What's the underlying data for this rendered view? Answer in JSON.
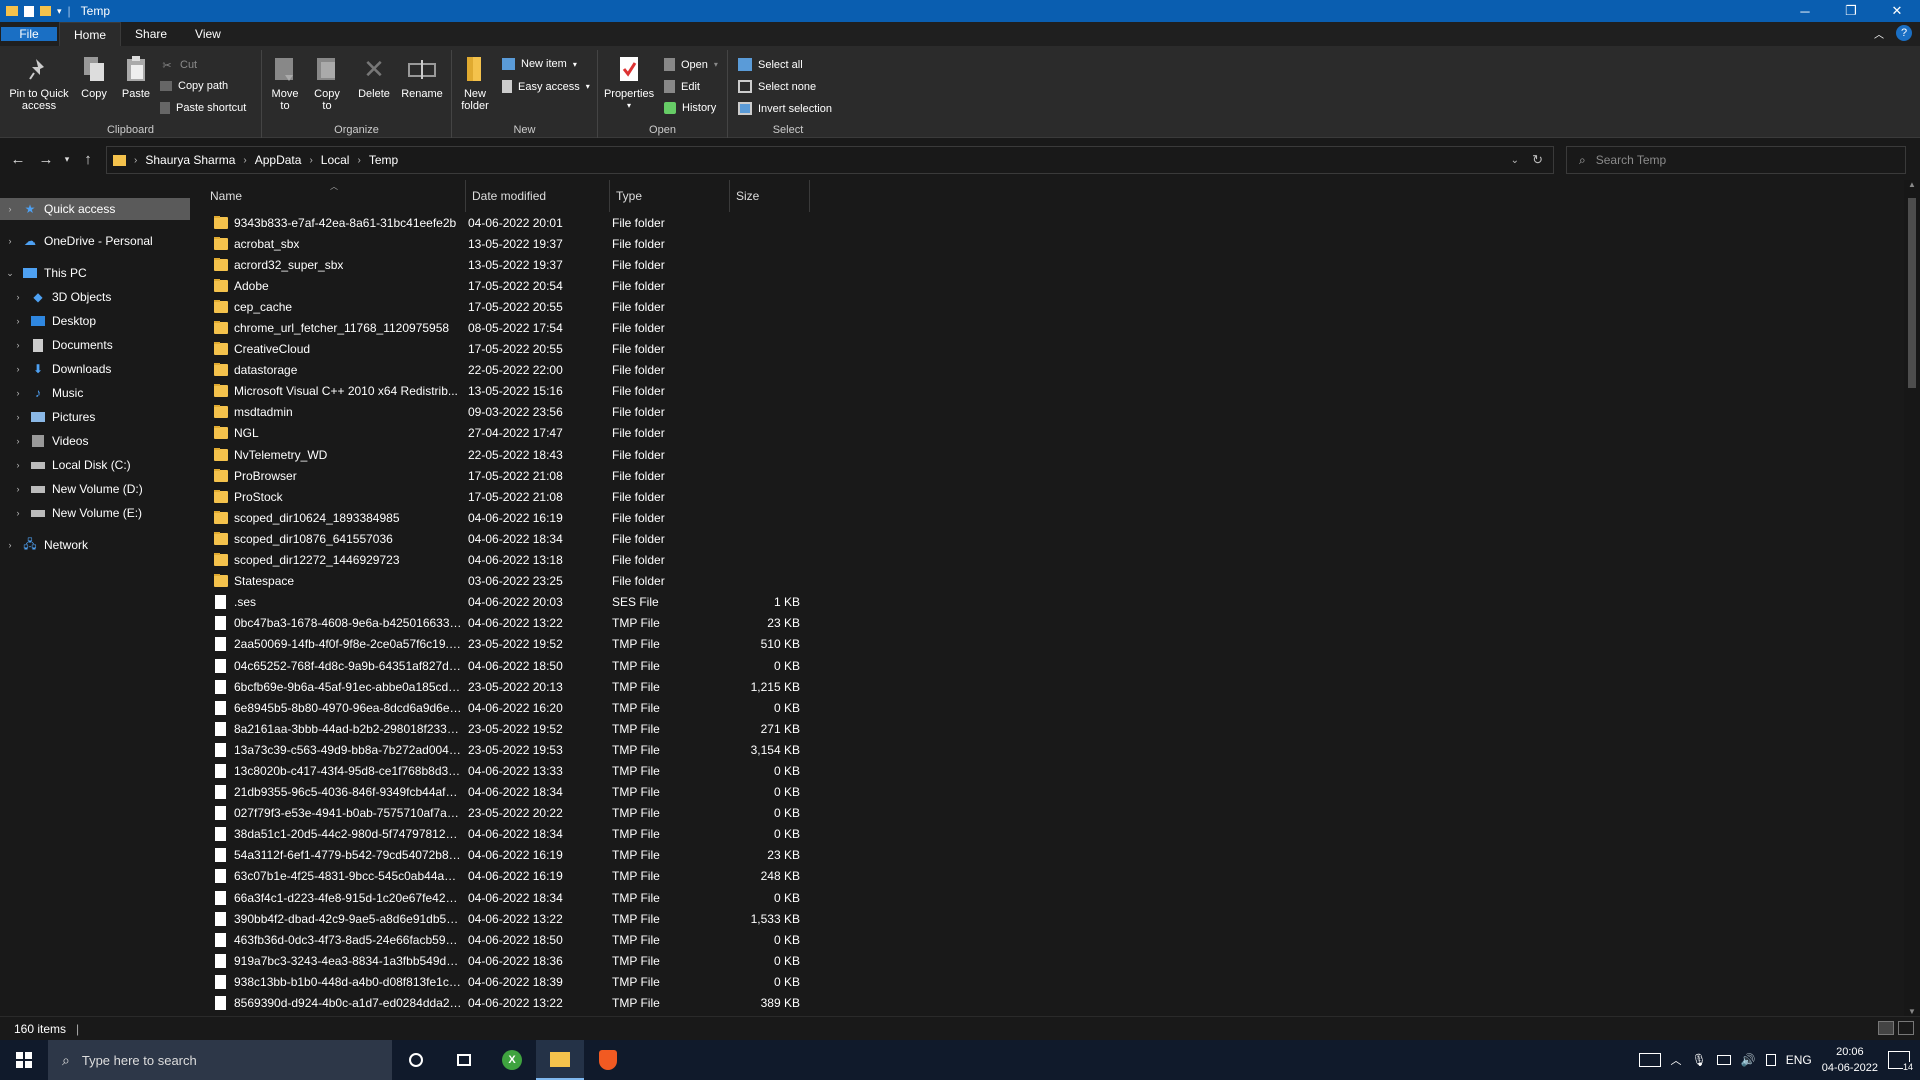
{
  "window": {
    "title": "Temp",
    "controls": {
      "minimize": "─",
      "restore": "❐",
      "close": "✕"
    }
  },
  "ribbon_tabs": [
    "File",
    "Home",
    "Share",
    "View"
  ],
  "ribbon": {
    "clipboard": {
      "label": "Clipboard",
      "pin": "Pin to Quick access",
      "copy": "Copy",
      "paste": "Paste",
      "cut": "Cut",
      "copy_path": "Copy path",
      "paste_shortcut": "Paste shortcut"
    },
    "organize": {
      "label": "Organize",
      "move_to": "Move to",
      "copy_to": "Copy to",
      "delete": "Delete",
      "rename": "Rename"
    },
    "new": {
      "label": "New",
      "new_folder": "New folder",
      "new_item": "New item",
      "easy_access": "Easy access"
    },
    "open": {
      "label": "Open",
      "properties": "Properties",
      "open": "Open",
      "edit": "Edit",
      "history": "History"
    },
    "select": {
      "label": "Select",
      "select_all": "Select all",
      "select_none": "Select none",
      "invert": "Invert selection"
    }
  },
  "breadcrumb": [
    "Shaurya Sharma",
    "AppData",
    "Local",
    "Temp"
  ],
  "search": {
    "placeholder": "Search Temp"
  },
  "nav": {
    "quick_access": "Quick access",
    "onedrive": "OneDrive - Personal",
    "this_pc": "This PC",
    "objects3d": "3D Objects",
    "desktop": "Desktop",
    "documents": "Documents",
    "downloads": "Downloads",
    "music": "Music",
    "pictures": "Pictures",
    "videos": "Videos",
    "local_c": "Local Disk (C:)",
    "vol_d": "New Volume (D:)",
    "vol_e": "New Volume (E:)",
    "network": "Network"
  },
  "columns": {
    "name": "Name",
    "date": "Date modified",
    "type": "Type",
    "size": "Size"
  },
  "files": [
    {
      "name": "9343b833-e7af-42ea-8a61-31bc41eefe2b",
      "date": "04-06-2022 20:01",
      "type": "File folder",
      "size": "",
      "kind": "folder"
    },
    {
      "name": "acrobat_sbx",
      "date": "13-05-2022 19:37",
      "type": "File folder",
      "size": "",
      "kind": "folder"
    },
    {
      "name": "acrord32_super_sbx",
      "date": "13-05-2022 19:37",
      "type": "File folder",
      "size": "",
      "kind": "folder"
    },
    {
      "name": "Adobe",
      "date": "17-05-2022 20:54",
      "type": "File folder",
      "size": "",
      "kind": "folder"
    },
    {
      "name": "cep_cache",
      "date": "17-05-2022 20:55",
      "type": "File folder",
      "size": "",
      "kind": "folder"
    },
    {
      "name": "chrome_url_fetcher_11768_1120975958",
      "date": "08-05-2022 17:54",
      "type": "File folder",
      "size": "",
      "kind": "folder"
    },
    {
      "name": "CreativeCloud",
      "date": "17-05-2022 20:55",
      "type": "File folder",
      "size": "",
      "kind": "folder"
    },
    {
      "name": "datastorage",
      "date": "22-05-2022 22:00",
      "type": "File folder",
      "size": "",
      "kind": "folder"
    },
    {
      "name": "Microsoft Visual C++ 2010  x64 Redistrib...",
      "date": "13-05-2022 15:16",
      "type": "File folder",
      "size": "",
      "kind": "folder"
    },
    {
      "name": "msdtadmin",
      "date": "09-03-2022 23:56",
      "type": "File folder",
      "size": "",
      "kind": "folder"
    },
    {
      "name": "NGL",
      "date": "27-04-2022 17:47",
      "type": "File folder",
      "size": "",
      "kind": "folder"
    },
    {
      "name": "NvTelemetry_WD",
      "date": "22-05-2022 18:43",
      "type": "File folder",
      "size": "",
      "kind": "folder"
    },
    {
      "name": "ProBrowser",
      "date": "17-05-2022 21:08",
      "type": "File folder",
      "size": "",
      "kind": "folder"
    },
    {
      "name": "ProStock",
      "date": "17-05-2022 21:08",
      "type": "File folder",
      "size": "",
      "kind": "folder"
    },
    {
      "name": "scoped_dir10624_1893384985",
      "date": "04-06-2022 16:19",
      "type": "File folder",
      "size": "",
      "kind": "folder"
    },
    {
      "name": "scoped_dir10876_641557036",
      "date": "04-06-2022 18:34",
      "type": "File folder",
      "size": "",
      "kind": "folder"
    },
    {
      "name": "scoped_dir12272_1446929723",
      "date": "04-06-2022 13:18",
      "type": "File folder",
      "size": "",
      "kind": "folder"
    },
    {
      "name": "Statespace",
      "date": "03-06-2022 23:25",
      "type": "File folder",
      "size": "",
      "kind": "folder"
    },
    {
      "name": ".ses",
      "date": "04-06-2022 20:03",
      "type": "SES File",
      "size": "1 KB",
      "kind": "file"
    },
    {
      "name": "0bc47ba3-1678-4608-9e6a-b42501663338...",
      "date": "04-06-2022 13:22",
      "type": "TMP File",
      "size": "23 KB",
      "kind": "file"
    },
    {
      "name": "2aa50069-14fb-4f0f-9f8e-2ce0a57f6c19.t...",
      "date": "23-05-2022 19:52",
      "type": "TMP File",
      "size": "510 KB",
      "kind": "file"
    },
    {
      "name": "04c65252-768f-4d8c-9a9b-64351af827da...",
      "date": "04-06-2022 18:50",
      "type": "TMP File",
      "size": "0 KB",
      "kind": "file"
    },
    {
      "name": "6bcfb69e-9b6a-45af-91ec-abbe0a185cd6...",
      "date": "23-05-2022 20:13",
      "type": "TMP File",
      "size": "1,215 KB",
      "kind": "file"
    },
    {
      "name": "6e8945b5-8b80-4970-96ea-8dcd6a9d6e5f...",
      "date": "04-06-2022 16:20",
      "type": "TMP File",
      "size": "0 KB",
      "kind": "file"
    },
    {
      "name": "8a2161aa-3bbb-44ad-b2b2-298018f23323...",
      "date": "23-05-2022 19:52",
      "type": "TMP File",
      "size": "271 KB",
      "kind": "file"
    },
    {
      "name": "13a73c39-c563-49d9-bb8a-7b272ad00445...",
      "date": "23-05-2022 19:53",
      "type": "TMP File",
      "size": "3,154 KB",
      "kind": "file"
    },
    {
      "name": "13c8020b-c417-43f4-95d8-ce1f768b8d33...",
      "date": "04-06-2022 13:33",
      "type": "TMP File",
      "size": "0 KB",
      "kind": "file"
    },
    {
      "name": "21db9355-96c5-4036-846f-9349fcb44af6.t...",
      "date": "04-06-2022 18:34",
      "type": "TMP File",
      "size": "0 KB",
      "kind": "file"
    },
    {
      "name": "027f79f3-e53e-4941-b0ab-7575710af7a1.t...",
      "date": "23-05-2022 20:22",
      "type": "TMP File",
      "size": "0 KB",
      "kind": "file"
    },
    {
      "name": "38da51c1-20d5-44c2-980d-5f74797812e0...",
      "date": "04-06-2022 18:34",
      "type": "TMP File",
      "size": "0 KB",
      "kind": "file"
    },
    {
      "name": "54a3112f-6ef1-4779-b542-79cd54072b8f.t...",
      "date": "04-06-2022 16:19",
      "type": "TMP File",
      "size": "23 KB",
      "kind": "file"
    },
    {
      "name": "63c07b1e-4f25-4831-9bcc-545c0ab44a10...",
      "date": "04-06-2022 16:19",
      "type": "TMP File",
      "size": "248 KB",
      "kind": "file"
    },
    {
      "name": "66a3f4c1-d223-4fe8-915d-1c20e67fe422.t...",
      "date": "04-06-2022 18:34",
      "type": "TMP File",
      "size": "0 KB",
      "kind": "file"
    },
    {
      "name": "390bb4f2-dbad-42c9-9ae5-a8d6e91db58...",
      "date": "04-06-2022 13:22",
      "type": "TMP File",
      "size": "1,533 KB",
      "kind": "file"
    },
    {
      "name": "463fb36d-0dc3-4f73-8ad5-24e66facb59c....",
      "date": "04-06-2022 18:50",
      "type": "TMP File",
      "size": "0 KB",
      "kind": "file"
    },
    {
      "name": "919a7bc3-3243-4ea3-8834-1a3fbb549d0f....",
      "date": "04-06-2022 18:36",
      "type": "TMP File",
      "size": "0 KB",
      "kind": "file"
    },
    {
      "name": "938c13bb-b1b0-448d-a4b0-d08f813fe1cd...",
      "date": "04-06-2022 18:39",
      "type": "TMP File",
      "size": "0 KB",
      "kind": "file"
    },
    {
      "name": "8569390d-d924-4b0c-a1d7-ed0284dda21...",
      "date": "04-06-2022 13:22",
      "type": "TMP File",
      "size": "389 KB",
      "kind": "file"
    }
  ],
  "status": {
    "item_count": "160 items"
  },
  "taskbar": {
    "search_placeholder": "Type here to search",
    "language": "ENG",
    "time": "20:06",
    "date": "04-06-2022",
    "notifications": "14"
  }
}
